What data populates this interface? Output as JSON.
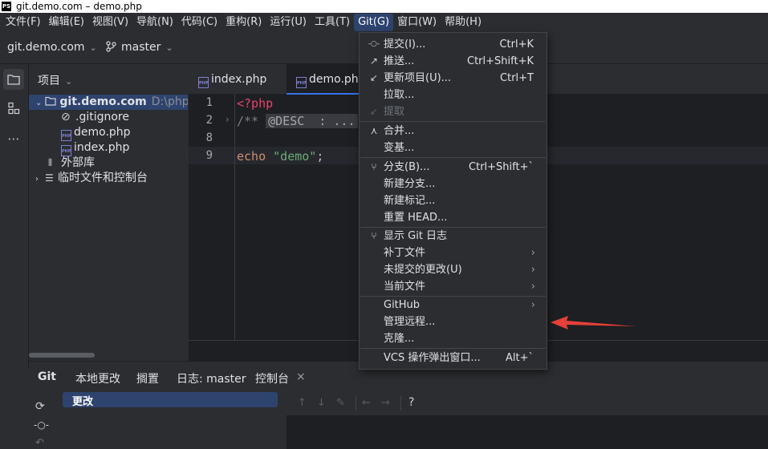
{
  "window": {
    "title": "git.demo.com – demo.php",
    "app_icon": "PS"
  },
  "menubar": {
    "items": [
      "文件(F)",
      "编辑(E)",
      "视图(V)",
      "导航(N)",
      "代码(C)",
      "重构(R)",
      "运行(U)",
      "工具(T)",
      "Git(G)",
      "窗口(W)",
      "帮助(H)"
    ],
    "active_index": 8
  },
  "toolbar": {
    "project": "git.demo.com",
    "branch": "master"
  },
  "project_panel": {
    "header": "项目",
    "root": {
      "name": "git.demo.com",
      "path": "D:\\phpst"
    },
    "files": [
      ".gitignore",
      "demo.php",
      "index.php"
    ],
    "external": "外部库",
    "scratch": "临时文件和控制台"
  },
  "editor": {
    "tabs": [
      "index.php",
      "demo.php"
    ],
    "active_tab": 1,
    "line_numbers": [
      "1",
      "2",
      "8",
      "9"
    ],
    "code": {
      "l1": "<?php",
      "l2_comment": "/**",
      "l2_fold": "@DESC  : ...",
      "l9_keyword": "echo",
      "l9_string": "\"demo\"",
      "l9_end": ";"
    }
  },
  "bottom_panel": {
    "tool_title": "Git",
    "tabs": [
      "本地更改",
      "搁置",
      "日志: master",
      "控制台"
    ],
    "close_glyph": "×",
    "changes_node": "更改",
    "help_glyph": "?"
  },
  "git_menu": {
    "items": [
      {
        "icon": "commit-icon",
        "glyph": "-○-",
        "label": "提交(I)...",
        "shortcut": "Ctrl+K"
      },
      {
        "icon": "push-icon",
        "glyph": "↗",
        "label": "推送...",
        "shortcut": "Ctrl+Shift+K"
      },
      {
        "icon": "update-icon",
        "glyph": "↙",
        "label": "更新项目(U)...",
        "shortcut": "Ctrl+T"
      },
      {
        "icon": "",
        "glyph": "",
        "label": "拉取...",
        "shortcut": ""
      },
      {
        "icon": "fetch-icon",
        "glyph": "↙",
        "label": "提取",
        "shortcut": "",
        "disabled": true
      },
      {
        "icon": "merge-icon",
        "glyph": "⋏",
        "label": "合并...",
        "shortcut": ""
      },
      {
        "icon": "",
        "glyph": "",
        "label": "变基...",
        "shortcut": ""
      },
      {
        "icon": "branch-icon",
        "glyph": "⑂",
        "label": "分支(B)...",
        "shortcut": "Ctrl+Shift+`"
      },
      {
        "icon": "",
        "glyph": "",
        "label": "新建分支...",
        "shortcut": ""
      },
      {
        "icon": "",
        "glyph": "",
        "label": "新建标记...",
        "shortcut": ""
      },
      {
        "icon": "",
        "glyph": "",
        "label": "重置 HEAD...",
        "shortcut": ""
      },
      {
        "icon": "git-log-icon",
        "glyph": "⑂",
        "label": "显示 Git 日志",
        "shortcut": ""
      },
      {
        "icon": "",
        "glyph": "",
        "label": "补丁文件",
        "shortcut": "",
        "submenu": true
      },
      {
        "icon": "",
        "glyph": "",
        "label": "未提交的更改(U)",
        "shortcut": "",
        "submenu": true
      },
      {
        "icon": "",
        "glyph": "",
        "label": "当前文件",
        "shortcut": "",
        "submenu": true
      },
      {
        "icon": "",
        "glyph": "",
        "label": "GitHub",
        "shortcut": "",
        "submenu": true
      },
      {
        "icon": "",
        "glyph": "",
        "label": "管理远程...",
        "shortcut": ""
      },
      {
        "icon": "",
        "glyph": "",
        "label": "克隆...",
        "shortcut": ""
      },
      {
        "icon": "",
        "glyph": "",
        "label": "VCS 操作弹出窗口...",
        "shortcut": "Alt+`"
      }
    ]
  },
  "annotation": {
    "color": "#e5403a",
    "points_to": "管理远程..."
  },
  "colors": {
    "accent": "#3574f0",
    "selection": "#2e436e",
    "php_tag": "#e8436f",
    "string": "#6aab73",
    "keyword": "#cf8e6d"
  }
}
